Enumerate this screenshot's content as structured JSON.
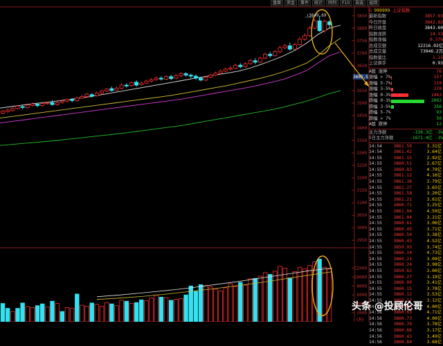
{
  "toolbar": {
    "tabs": [
      "盘面",
      "资金",
      "事件",
      "统计",
      "同列",
      "F10",
      "自选",
      "返回"
    ]
  },
  "chart_data": {
    "type": "candlestick",
    "y_ticks": [
      "3850",
      "3800",
      "3750",
      "3700",
      "3650",
      "3600",
      "3550",
      "3500",
      "3450",
      "3400",
      "3350",
      "3300",
      "3250",
      "3200",
      "3150",
      "3100",
      "3050",
      "3000",
      "2950"
    ],
    "y_highlight": "3605.5",
    "peak_label": "3849.69",
    "vol_ticks": [
      "12000",
      "10000",
      "8000",
      "6000",
      "4000",
      "2000"
    ],
    "bottom_label": "(万)",
    "candles": [
      {
        "o": 3460,
        "c": 3468,
        "h": 3472,
        "l": 3456
      },
      {
        "o": 3466,
        "c": 3472,
        "h": 3478,
        "l": 3462
      },
      {
        "o": 3470,
        "c": 3478,
        "h": 3482,
        "l": 3466
      },
      {
        "o": 3478,
        "c": 3488,
        "h": 3492,
        "l": 3474
      },
      {
        "o": 3486,
        "c": 3482,
        "h": 3494,
        "l": 3476
      },
      {
        "o": 3482,
        "c": 3492,
        "h": 3498,
        "l": 3478
      },
      {
        "o": 3490,
        "c": 3496,
        "h": 3502,
        "l": 3486
      },
      {
        "o": 3496,
        "c": 3490,
        "h": 3500,
        "l": 3484
      },
      {
        "o": 3490,
        "c": 3498,
        "h": 3504,
        "l": 3486
      },
      {
        "o": 3498,
        "c": 3500,
        "h": 3506,
        "l": 3494
      },
      {
        "o": 3502,
        "c": 3494,
        "h": 3512,
        "l": 3490
      },
      {
        "o": 3494,
        "c": 3502,
        "h": 3508,
        "l": 3490
      },
      {
        "o": 3502,
        "c": 3508,
        "h": 3514,
        "l": 3498
      },
      {
        "o": 3508,
        "c": 3514,
        "h": 3518,
        "l": 3504
      },
      {
        "o": 3514,
        "c": 3510,
        "h": 3520,
        "l": 3504
      },
      {
        "o": 3510,
        "c": 3520,
        "h": 3526,
        "l": 3506
      },
      {
        "o": 3520,
        "c": 3526,
        "h": 3532,
        "l": 3516
      },
      {
        "o": 3526,
        "c": 3536,
        "h": 3540,
        "l": 3522
      },
      {
        "o": 3534,
        "c": 3528,
        "h": 3540,
        "l": 3522
      },
      {
        "o": 3530,
        "c": 3540,
        "h": 3546,
        "l": 3526
      },
      {
        "o": 3540,
        "c": 3548,
        "h": 3552,
        "l": 3536
      },
      {
        "o": 3548,
        "c": 3556,
        "h": 3560,
        "l": 3544
      },
      {
        "o": 3558,
        "c": 3550,
        "h": 3566,
        "l": 3546
      },
      {
        "o": 3552,
        "c": 3560,
        "h": 3566,
        "l": 3548
      },
      {
        "o": 3560,
        "c": 3572,
        "h": 3578,
        "l": 3556
      },
      {
        "o": 3572,
        "c": 3568,
        "h": 3580,
        "l": 3562
      },
      {
        "o": 3570,
        "c": 3582,
        "h": 3586,
        "l": 3566
      },
      {
        "o": 3584,
        "c": 3572,
        "h": 3592,
        "l": 3566
      },
      {
        "o": 3574,
        "c": 3580,
        "h": 3586,
        "l": 3570
      },
      {
        "o": 3580,
        "c": 3588,
        "h": 3594,
        "l": 3576
      },
      {
        "o": 3588,
        "c": 3594,
        "h": 3600,
        "l": 3584
      },
      {
        "o": 3594,
        "c": 3600,
        "h": 3606,
        "l": 3590
      },
      {
        "o": 3600,
        "c": 3596,
        "h": 3608,
        "l": 3590
      },
      {
        "o": 3596,
        "c": 3606,
        "h": 3612,
        "l": 3592
      },
      {
        "o": 3606,
        "c": 3598,
        "h": 3614,
        "l": 3592
      },
      {
        "o": 3600,
        "c": 3610,
        "h": 3616,
        "l": 3596
      },
      {
        "o": 3610,
        "c": 3618,
        "h": 3624,
        "l": 3604
      },
      {
        "o": 3618,
        "c": 3612,
        "h": 3624,
        "l": 3606
      },
      {
        "o": 3612,
        "c": 3608,
        "h": 3618,
        "l": 3600
      },
      {
        "o": 3608,
        "c": 3600,
        "h": 3614,
        "l": 3594
      },
      {
        "o": 3600,
        "c": 3592,
        "h": 3606,
        "l": 3588
      },
      {
        "o": 3592,
        "c": 3604,
        "h": 3610,
        "l": 3588
      },
      {
        "o": 3604,
        "c": 3612,
        "h": 3618,
        "l": 3600
      },
      {
        "o": 3612,
        "c": 3620,
        "h": 3626,
        "l": 3608
      },
      {
        "o": 3620,
        "c": 3628,
        "h": 3634,
        "l": 3616
      },
      {
        "o": 3628,
        "c": 3636,
        "h": 3642,
        "l": 3624
      },
      {
        "o": 3636,
        "c": 3640,
        "h": 3648,
        "l": 3630
      },
      {
        "o": 3640,
        "c": 3652,
        "h": 3658,
        "l": 3636
      },
      {
        "o": 3652,
        "c": 3646,
        "h": 3660,
        "l": 3640
      },
      {
        "o": 3646,
        "c": 3658,
        "h": 3664,
        "l": 3642
      },
      {
        "o": 3658,
        "c": 3670,
        "h": 3676,
        "l": 3654
      },
      {
        "o": 3670,
        "c": 3664,
        "h": 3680,
        "l": 3656
      },
      {
        "o": 3664,
        "c": 3680,
        "h": 3686,
        "l": 3660
      },
      {
        "o": 3680,
        "c": 3696,
        "h": 3702,
        "l": 3676
      },
      {
        "o": 3696,
        "c": 3690,
        "h": 3706,
        "l": 3682
      },
      {
        "o": 3690,
        "c": 3706,
        "h": 3712,
        "l": 3686
      },
      {
        "o": 3706,
        "c": 3722,
        "h": 3730,
        "l": 3700
      },
      {
        "o": 3722,
        "c": 3730,
        "h": 3738,
        "l": 3716
      },
      {
        "o": 3730,
        "c": 3716,
        "h": 3742,
        "l": 3710
      },
      {
        "o": 3716,
        "c": 3734,
        "h": 3742,
        "l": 3712
      },
      {
        "o": 3734,
        "c": 3756,
        "h": 3764,
        "l": 3730
      },
      {
        "o": 3756,
        "c": 3770,
        "h": 3780,
        "l": 3750
      },
      {
        "o": 3770,
        "c": 3800,
        "h": 3808,
        "l": 3766
      },
      {
        "o": 3800,
        "c": 3830,
        "h": 3836,
        "l": 3796
      },
      {
        "o": 3830,
        "c": 3790,
        "h": 3849.69,
        "l": 3786
      },
      {
        "o": 3790,
        "c": 3828,
        "h": 3834,
        "l": 3782
      },
      {
        "o": 3826,
        "c": 3814,
        "h": 3832,
        "l": 3802
      }
    ],
    "volumes": [
      {
        "v": 4100,
        "up": false
      },
      {
        "v": 3000,
        "up": false
      },
      {
        "v": 2300,
        "up": true
      },
      {
        "v": 3000,
        "up": false
      },
      {
        "v": 4200,
        "up": false
      },
      {
        "v": 3400,
        "up": true
      },
      {
        "v": 3200,
        "up": true
      },
      {
        "v": 3600,
        "up": false
      },
      {
        "v": 4000,
        "up": false
      },
      {
        "v": 3300,
        "up": true
      },
      {
        "v": 4600,
        "up": false
      },
      {
        "v": 4100,
        "up": true
      },
      {
        "v": 2300,
        "up": false
      },
      {
        "v": 3200,
        "up": true
      },
      {
        "v": 3000,
        "up": true
      },
      {
        "v": 6200,
        "up": false
      },
      {
        "v": 3700,
        "up": true
      },
      {
        "v": 3500,
        "up": true
      },
      {
        "v": 4200,
        "up": false
      },
      {
        "v": 3900,
        "up": true
      },
      {
        "v": 3500,
        "up": true
      },
      {
        "v": 4300,
        "up": true
      },
      {
        "v": 4000,
        "up": false
      },
      {
        "v": 3600,
        "up": true
      },
      {
        "v": 4800,
        "up": true
      },
      {
        "v": 4600,
        "up": false
      },
      {
        "v": 4100,
        "up": true
      },
      {
        "v": 4300,
        "up": false
      },
      {
        "v": 4900,
        "up": false
      },
      {
        "v": 4700,
        "up": true
      },
      {
        "v": 5300,
        "up": true
      },
      {
        "v": 6000,
        "up": true
      },
      {
        "v": 5500,
        "up": false
      },
      {
        "v": 5400,
        "up": true
      },
      {
        "v": 4800,
        "up": false
      },
      {
        "v": 5000,
        "up": true
      },
      {
        "v": 5200,
        "up": true
      },
      {
        "v": 6000,
        "up": false
      },
      {
        "v": 8000,
        "up": false
      },
      {
        "v": 6800,
        "up": false
      },
      {
        "v": 8300,
        "up": false
      },
      {
        "v": 8100,
        "up": true
      },
      {
        "v": 7800,
        "up": true
      },
      {
        "v": 7300,
        "up": true
      },
      {
        "v": 6900,
        "up": true
      },
      {
        "v": 7600,
        "up": true
      },
      {
        "v": 8500,
        "up": true
      },
      {
        "v": 7900,
        "up": true
      },
      {
        "v": 8800,
        "up": false
      },
      {
        "v": 8200,
        "up": true
      },
      {
        "v": 9600,
        "up": true
      },
      {
        "v": 9700,
        "up": false
      },
      {
        "v": 10200,
        "up": true
      },
      {
        "v": 11000,
        "up": true
      },
      {
        "v": 10600,
        "up": false
      },
      {
        "v": 11300,
        "up": true
      },
      {
        "v": 12400,
        "up": true
      },
      {
        "v": 12000,
        "up": true
      },
      {
        "v": 9800,
        "up": false
      },
      {
        "v": 11200,
        "up": true
      },
      {
        "v": 12200,
        "up": true
      },
      {
        "v": 11800,
        "up": true
      },
      {
        "v": 12600,
        "up": true
      },
      {
        "v": 13400,
        "up": true
      },
      {
        "v": 14000,
        "up": false
      },
      {
        "v": 12200,
        "up": true
      },
      {
        "v": 11800,
        "up": true
      }
    ],
    "ma_white": [
      3480,
      3486,
      3492,
      3498,
      3503,
      3508,
      3514,
      3520,
      3526,
      3534,
      3542,
      3550,
      3558,
      3566,
      3574,
      3582,
      3590,
      3598,
      3606,
      3613,
      3620,
      3628,
      3640,
      3655,
      3672,
      3690,
      3712,
      3740,
      3775,
      3800,
      3812
    ],
    "ma_yellow": [
      3440,
      3446,
      3452,
      3458,
      3464,
      3470,
      3476,
      3482,
      3488,
      3494,
      3500,
      3506,
      3512,
      3518,
      3524,
      3530,
      3538,
      3546,
      3554,
      3562,
      3570,
      3580,
      3590,
      3600,
      3612,
      3626,
      3642,
      3660,
      3690,
      3730,
      3760
    ],
    "ma_magenta": [
      3420,
      3426,
      3432,
      3438,
      3444,
      3450,
      3456,
      3462,
      3468,
      3474,
      3480,
      3486,
      3492,
      3498,
      3504,
      3510,
      3516,
      3524,
      3532,
      3540,
      3548,
      3556,
      3564,
      3574,
      3584,
      3596,
      3612,
      3630,
      3660,
      3690,
      3705
    ],
    "ma_green": [
      3330,
      3334,
      3338,
      3342,
      3346,
      3350,
      3355,
      3360,
      3365,
      3370,
      3375,
      3380,
      3386,
      3392,
      3398,
      3404,
      3410,
      3418,
      3426,
      3434,
      3442,
      3450,
      3458,
      3466,
      3474,
      3484,
      3496,
      3508,
      3522,
      3538,
      3550
    ]
  },
  "panel": {
    "header": {
      "marker": "G",
      "code": "999999",
      "name": "上证指数"
    },
    "quotes": [
      {
        "label": "最新指数",
        "value": "3857.93",
        "cls": "up"
      },
      {
        "label": "今日开盘",
        "value": "3842.82",
        "cls": "up"
      },
      {
        "label": "昨日收盘",
        "value": "3843.60",
        "cls": "wh"
      },
      {
        "label": "指数涨跌",
        "value": "14.33",
        "cls": "up"
      },
      {
        "label": "指数涨幅",
        "value": "0.37%",
        "cls": "up"
      },
      {
        "label": "总成交额",
        "value": "12216.92亿",
        "cls": "wh"
      },
      {
        "label": "总成交量",
        "value": "73946.2万",
        "cls": "wh"
      },
      {
        "label": "指数量比",
        "value": "1.15",
        "cls": "up"
      },
      {
        "label": "上证换手",
        "value": "0.93",
        "cls": "wh"
      }
    ],
    "distribution": [
      {
        "label": "A股 涨停",
        "count": "76",
        "cls": "up",
        "pct": 0
      },
      {
        "label": "涨幅 > 7%",
        "count": "157",
        "cls": "up",
        "pct": 0.02
      },
      {
        "label": "涨幅 5-7%",
        "count": "119",
        "cls": "up",
        "pct": 0.02
      },
      {
        "label": "涨幅 3-5%",
        "count": "278",
        "cls": "up",
        "pct": 0.05
      },
      {
        "label": "涨幅 0-3%",
        "count": "1443",
        "cls": "up",
        "pct": 0.5
      },
      {
        "label": "跌幅 0-3%",
        "count": "2002",
        "cls": "dn",
        "pct": 0.95
      },
      {
        "label": "跌幅 3-5%",
        "count": "356",
        "cls": "dn",
        "pct": 0.08
      },
      {
        "label": "跌幅 5-7%",
        "count": "93",
        "cls": "dn",
        "pct": 0
      },
      {
        "label": "跌幅 > 7%",
        "count": "50",
        "cls": "dn",
        "pct": 0
      },
      {
        "label": "A股 跌停",
        "count": "12",
        "cls": "dn",
        "pct": 0
      }
    ],
    "flows": [
      {
        "label": "主力净额",
        "value": "-339.3亿",
        "pct": "-3%"
      },
      {
        "label": "5日主力净额",
        "value": "-1671.4亿",
        "pct": "-3%"
      }
    ],
    "ticks": [
      [
        "14:54",
        "3861.59",
        "3.31亿"
      ],
      [
        "14:54",
        "3861.42",
        "3.64亿"
      ],
      [
        "14:55",
        "3861.15",
        "2.92亿"
      ],
      [
        "14:55",
        "3860.51",
        "2.67亿"
      ],
      [
        "14:55",
        "3860.83",
        "4.79亿"
      ],
      [
        "14:55",
        "3861.12",
        "4.16亿"
      ],
      [
        "14:55",
        "3861.38",
        "2.79亿"
      ],
      [
        "14:55",
        "3861.27",
        "3.65亿"
      ],
      [
        "14:55",
        "3861.58",
        "3.20亿"
      ],
      [
        "14:55",
        "3861.21",
        "3.61亿"
      ],
      [
        "14:55",
        "3860.71",
        "3.25亿"
      ],
      [
        "14:55",
        "3861.04",
        "4.59亿"
      ],
      [
        "14:55",
        "3861.04",
        "3.21亿"
      ],
      [
        "14:55",
        "3860.61",
        "3.06亿"
      ],
      [
        "14:55",
        "3860.45",
        "3.71亿"
      ],
      [
        "14:55",
        "3860.54",
        "3.38亿"
      ],
      [
        "14:55",
        "3860.43",
        "4.52亿"
      ],
      [
        "14:55",
        "3859.93",
        "3.74亿"
      ],
      [
        "14:55",
        "3860.14",
        "4.73亿"
      ],
      [
        "14:55",
        "3860.21",
        "3.09亿"
      ],
      [
        "14:55",
        "3860.24",
        "3.98亿"
      ],
      [
        "14:55",
        "3859.62",
        "3.66亿"
      ],
      [
        "14:55",
        "3860.27",
        "3.19亿"
      ],
      [
        "14:55",
        "3860.09",
        "3.41亿"
      ],
      [
        "14:55",
        "3860.15",
        "3.78亿"
      ],
      [
        "14:55",
        "3860.12",
        "3.53亿"
      ],
      [
        "14:55",
        "3860.17",
        "3.12亿"
      ],
      [
        "14:55",
        "3860.05",
        "4.00亿"
      ],
      [
        "14:56",
        "3860.65",
        "4.71亿"
      ],
      [
        "14:56",
        "3860.73",
        "4.00亿"
      ],
      [
        "14:56",
        "3860.70",
        "3.78亿"
      ],
      [
        "14:56",
        "3860.66",
        "3.17亿"
      ],
      [
        "14:56",
        "3860.43",
        "3.49亿"
      ],
      [
        "14:56",
        "3860.84",
        "3.68亿"
      ]
    ]
  },
  "watermark": "头条 @投顾伦哥"
}
